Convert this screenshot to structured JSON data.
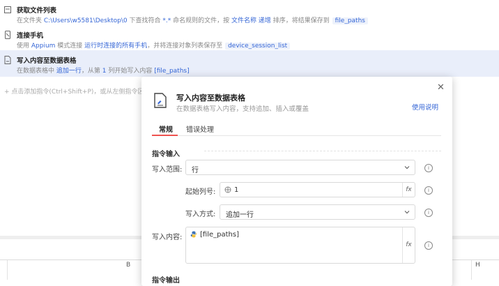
{
  "steps": [
    {
      "title": "获取文件列表",
      "desc": [
        {
          "t": "在文件夹 ",
          "k": "plain"
        },
        {
          "t": "C:\\Users\\w5581\\Desktop\\0",
          "k": "link"
        },
        {
          "t": " 下查找符合 ",
          "k": "plain"
        },
        {
          "t": "*.*",
          "k": "link"
        },
        {
          "t": " 命名规则的文件，按 ",
          "k": "plain"
        },
        {
          "t": "文件名称",
          "k": "link"
        },
        {
          "t": " ",
          "k": "plain"
        },
        {
          "t": "递增",
          "k": "link"
        },
        {
          "t": " 排序，将结果保存到 ",
          "k": "plain"
        },
        {
          "t": "file_paths",
          "k": "tag"
        }
      ]
    },
    {
      "title": "连接手机",
      "desc": [
        {
          "t": "使用 ",
          "k": "plain"
        },
        {
          "t": "Appium",
          "k": "link"
        },
        {
          "t": " 模式连接 ",
          "k": "plain"
        },
        {
          "t": "运行时连接的所有手机",
          "k": "link"
        },
        {
          "t": "，并将连接对象列表保存至 ",
          "k": "plain"
        },
        {
          "t": "device_session_list",
          "k": "tag"
        }
      ]
    },
    {
      "title": "写入内容至数据表格",
      "desc": [
        {
          "t": "在数据表格中 ",
          "k": "plain"
        },
        {
          "t": "追加一行",
          "k": "link"
        },
        {
          "t": "，从第 ",
          "k": "plain"
        },
        {
          "t": "1",
          "k": "link"
        },
        {
          "t": " 列开始写入内容 ",
          "k": "plain"
        },
        {
          "t": "[file_paths]",
          "k": "link"
        }
      ]
    }
  ],
  "hint": "+ 点击添加指令(Ctrl+Shift+P)，或从左侧指令区拖",
  "sheet": {
    "columns": [
      "B",
      "H"
    ]
  },
  "dialog": {
    "title": "写入内容至数据表格",
    "subtitle": "在数据表格写入内容，支持追加、插入或覆盖",
    "help": "使用说明",
    "close": "✕",
    "tabs": [
      "常规",
      "错误处理"
    ],
    "section": "指令输入",
    "fields": {
      "range_label": "写入范围:",
      "range_value": "行",
      "start_col_label": "起始列号:",
      "start_col_value": "1",
      "mode_label": "写入方式:",
      "mode_value": "追加一行",
      "content_label": "写入内容:",
      "content_value": "[file_paths]",
      "fx": "fx"
    },
    "section2": "指令输出"
  },
  "colors": {
    "link": "#3566d6",
    "active_row": "#e9eefa",
    "tab_underline": "#ef5350"
  }
}
